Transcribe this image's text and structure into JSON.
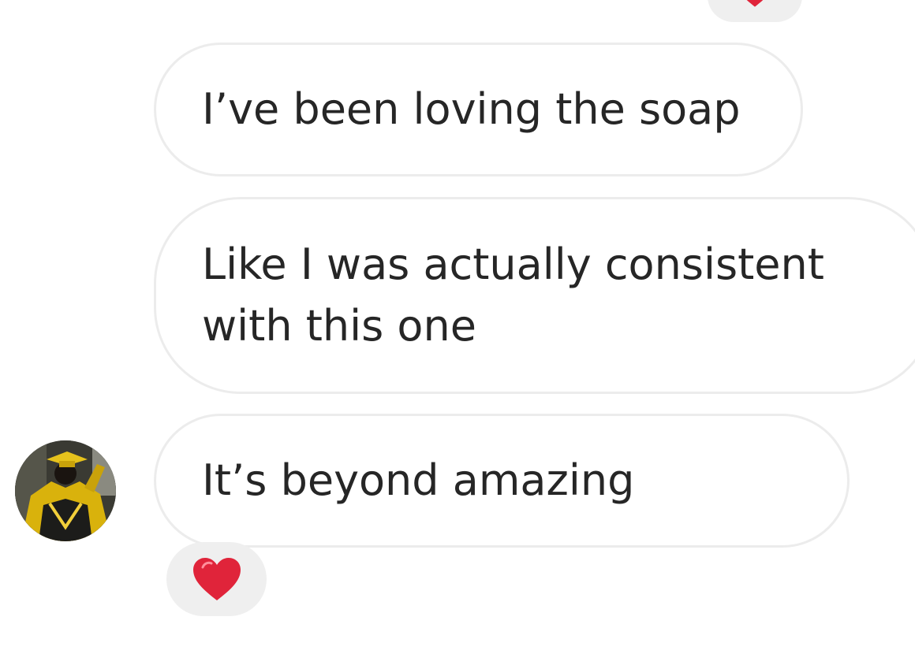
{
  "messages": [
    {
      "text": "I’ve been loving the soap"
    },
    {
      "text": "Like I was actually consistent\nwith this one"
    },
    {
      "text": "It’s beyond amazing"
    }
  ],
  "reactions": {
    "top": {
      "icon": "heart-icon",
      "color": "#e0243a"
    },
    "last_message": {
      "icon": "heart-icon",
      "color": "#e0243a"
    }
  },
  "avatar": {
    "icon": "profile-photo",
    "accent": "#d9b20c"
  },
  "colors": {
    "bubble_border": "#ececec",
    "reaction_bg": "#efefef",
    "text": "#262626"
  }
}
